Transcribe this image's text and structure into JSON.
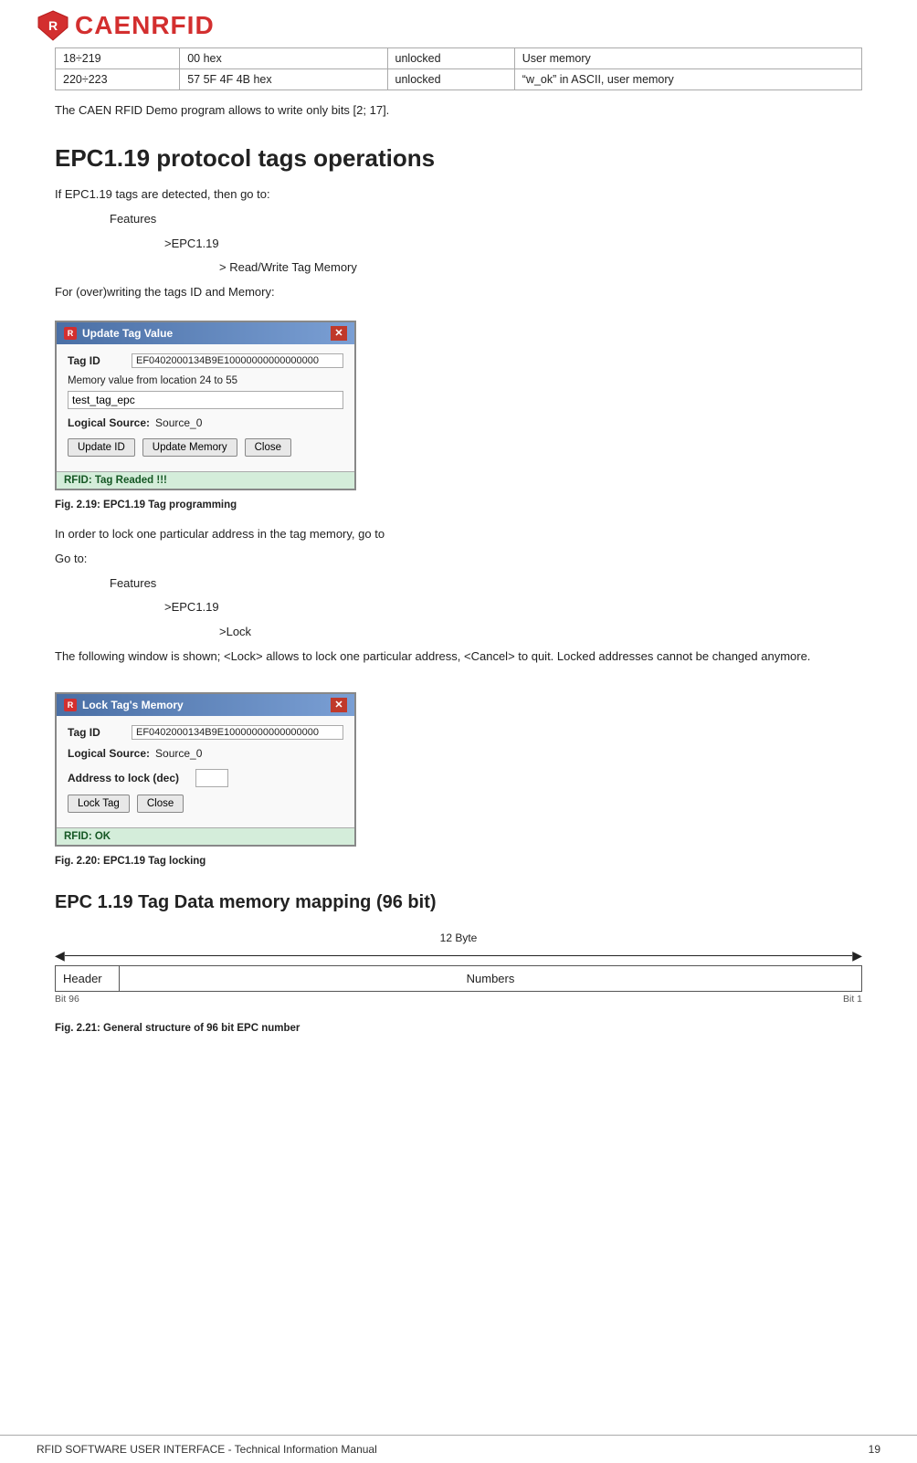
{
  "header": {
    "logo_alt": "CAENRFID",
    "logo_text": "CAENRFID"
  },
  "table": {
    "rows": [
      {
        "col1": "18÷219",
        "col2": "00 hex",
        "col3": "unlocked",
        "col4": "User memory"
      },
      {
        "col1": "220÷223",
        "col2": "57 5F 4F 4B hex",
        "col3": "unlocked",
        "col4": "“w_ok” in ASCII, user memory"
      }
    ]
  },
  "intro": {
    "text": "The CAEN RFID Demo program allows to write only bits [2; 17]."
  },
  "section1": {
    "heading": "EPC1.19 protocol tags operations",
    "para1": "If EPC1.19 tags are detected, then go to:",
    "indent1": "Features",
    "indent2": ">EPC1.19",
    "indent3": "> Read/Write Tag Memory",
    "para2": "For (over)writing the tags ID and Memory:"
  },
  "dialog1": {
    "title": "Update Tag Value",
    "tag_id_label": "Tag ID",
    "tag_id_value": "EF0402000134B9E10000000000000000",
    "memory_label": "Memory value from location 24 to 55",
    "memory_input_value": "test_tag_epc",
    "source_label": "Logical Source:",
    "source_value": "Source_0",
    "btn_update_id": "Update ID",
    "btn_update_memory": "Update Memory",
    "btn_close": "Close",
    "status": "RFID: Tag Readed !!!"
  },
  "fig1": {
    "caption": "Fig. 2.19: EPC1.19 Tag programming"
  },
  "section2": {
    "para1": "In order to lock one particular address in the tag memory, go to",
    "para2": "Go to:",
    "indent1": "Features",
    "indent2": ">EPC1.19",
    "indent3": ">Lock",
    "para3": "The following window is shown; <Lock> allows to lock one particular address, <Cancel> to quit. Locked addresses cannot be changed anymore."
  },
  "dialog2": {
    "title": "Lock Tag's Memory",
    "tag_id_label": "Tag ID",
    "tag_id_value": "EF0402000134B9E10000000000000000",
    "source_label": "Logical Source:",
    "source_value": "Source_0",
    "address_label": "Address to lock (dec)",
    "btn_lock": "Lock Tag",
    "btn_close": "Close",
    "status": "RFID: OK"
  },
  "fig2": {
    "caption": "Fig. 2.20: EPC1.19 Tag locking"
  },
  "section3": {
    "heading": "EPC 1.19 Tag Data memory mapping (96 bit)",
    "diagram_label": "12 Byte",
    "cell_header": "Header",
    "cell_numbers": "Numbers",
    "bit_left": "Bit 96",
    "bit_right": "Bit 1"
  },
  "fig3": {
    "caption": "Fig. 2.21: General structure of 96 bit EPC number"
  },
  "footer": {
    "left": "RFID SOFTWARE USER INTERFACE -  Technical Information Manual",
    "right": "19"
  }
}
